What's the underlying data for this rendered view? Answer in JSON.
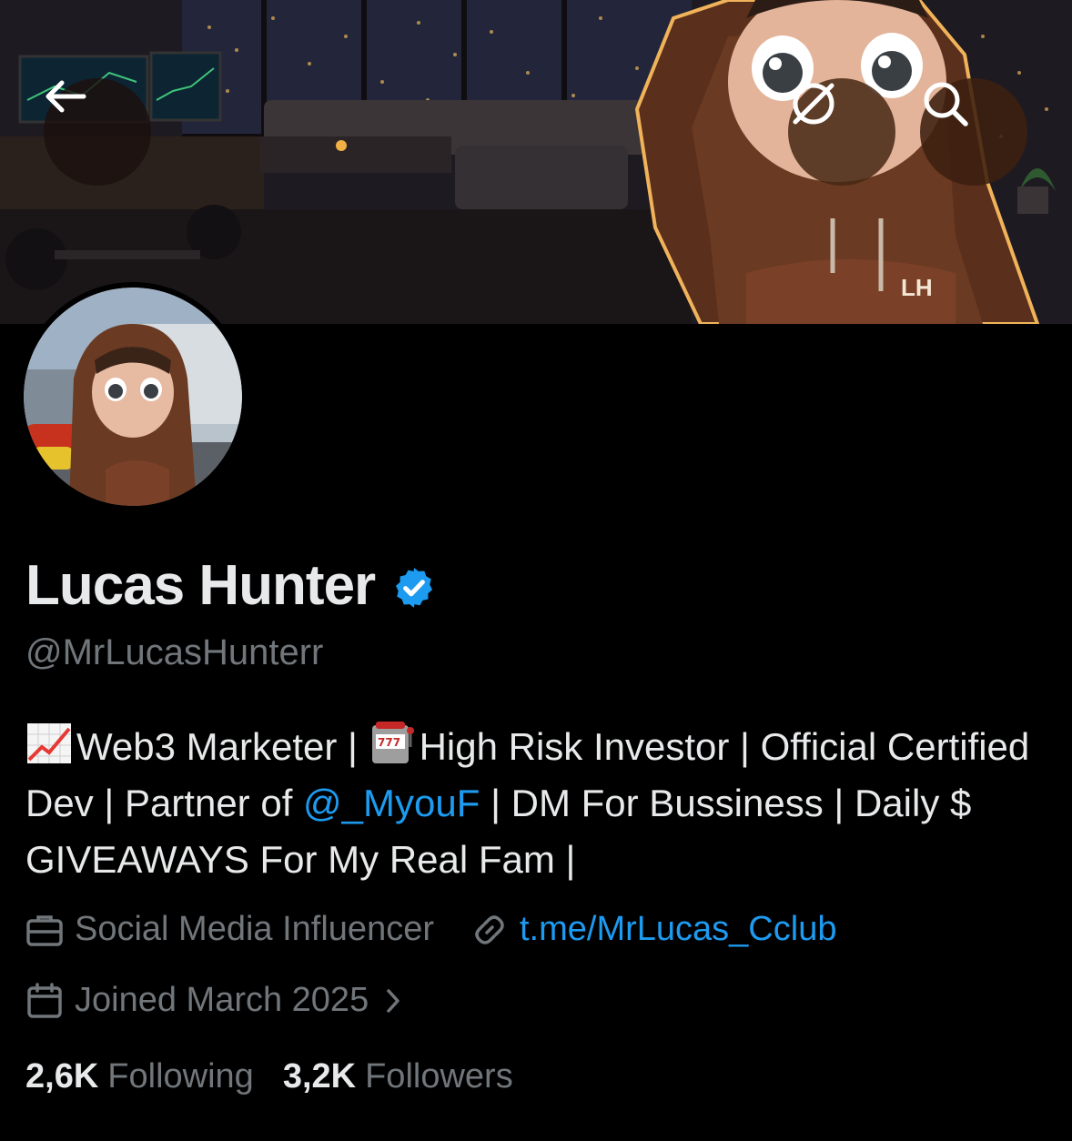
{
  "header": {
    "back_icon": "arrow-left-icon",
    "translate_icon": "globe-slash-icon",
    "search_icon": "search-icon",
    "banner_caption": "LH"
  },
  "profile": {
    "name": "Lucas Hunter",
    "verified": true,
    "handle": "@MrLucasHunterr",
    "bio": {
      "part1": "Web3 Marketer | ",
      "part2": "High Risk Investor | Official Certified Dev | Partner of ",
      "mention": "@_MyouF",
      "part3": " | DM For Bussiness | Daily $ GIVEAWAYS For My Real Fam |"
    },
    "category": "Social Media Influencer",
    "link": "t.me/MrLucas_Cclub",
    "joined": "Joined March 2025"
  },
  "stats": {
    "following_count": "2,6K",
    "following_label": "Following",
    "followers_count": "3,2K",
    "followers_label": "Followers"
  },
  "colors": {
    "accent": "#1d9bf0",
    "muted": "#71767b",
    "text": "#e7e9ea",
    "background": "#000000"
  }
}
